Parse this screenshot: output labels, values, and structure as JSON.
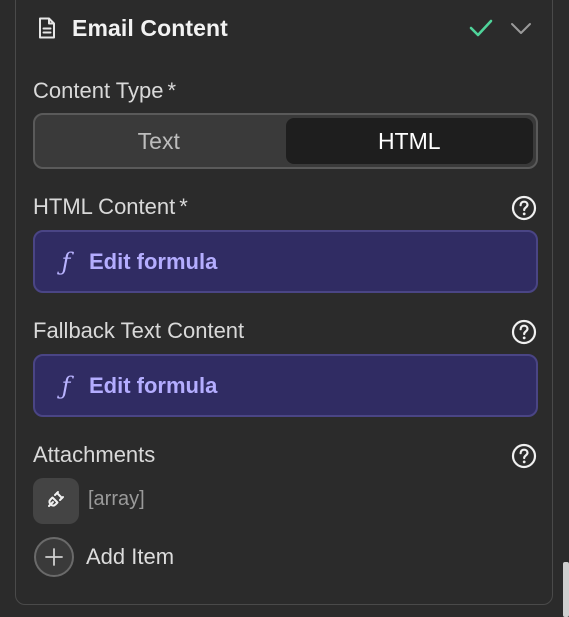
{
  "header": {
    "title": "Email Content",
    "doc_icon": "document-icon",
    "status_icon": "checkmark-icon",
    "status_color": "#4fd39a",
    "collapse_icon": "chevron-down-icon"
  },
  "content_type": {
    "label": "Content Type",
    "required_mark": "*",
    "options": [
      {
        "label": "Text",
        "selected": false
      },
      {
        "label": "HTML",
        "selected": true
      }
    ]
  },
  "html_content": {
    "label": "HTML Content",
    "required_mark": "*",
    "help_icon": "help-icon",
    "formula_icon": "ƒ",
    "formula_label": "Edit formula"
  },
  "fallback_text": {
    "label": "Fallback Text Content",
    "help_icon": "help-icon",
    "formula_icon": "ƒ",
    "formula_label": "Edit formula"
  },
  "attachments": {
    "label": "Attachments",
    "help_icon": "help-icon",
    "plug_icon": "plug-icon",
    "value_text": "[array]",
    "add_label": "Add Item",
    "add_icon": "plus-icon"
  },
  "colors": {
    "formula_bg": "#302c63",
    "formula_text": "#b4adff",
    "panel_bg": "#2b2b2b"
  }
}
